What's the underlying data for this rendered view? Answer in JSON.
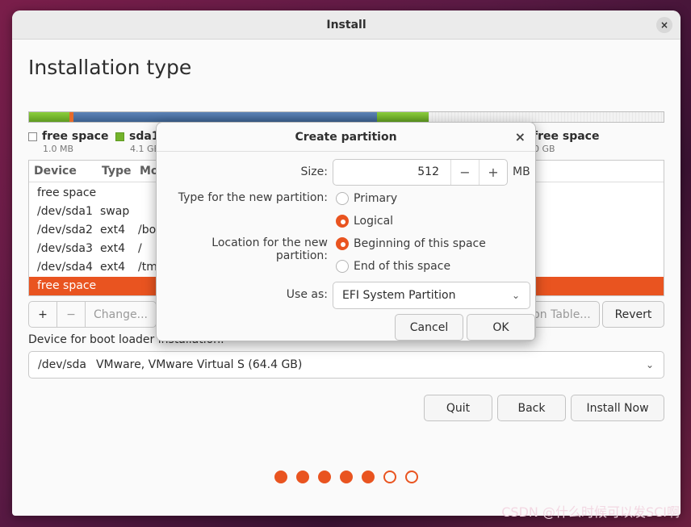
{
  "window": {
    "title": "Install",
    "close_glyph": "×"
  },
  "page_title": "Installation type",
  "partition_bar": {
    "legend": [
      {
        "label": "free space",
        "size": "1.0 MB",
        "color": "#f0f0f0"
      },
      {
        "label": "sda1",
        "size": "4.1 GB",
        "color": "#73b32b"
      },
      {
        "label": "free space",
        "size": "0 GB",
        "color": "#f0f0f0"
      }
    ]
  },
  "table": {
    "headers": [
      "Device",
      "Type",
      "Mo"
    ],
    "rows": [
      {
        "device": "free space",
        "type": "",
        "mount": ""
      },
      {
        "device": "/dev/sda1",
        "type": "swap",
        "mount": ""
      },
      {
        "device": "/dev/sda2",
        "type": "ext4",
        "mount": "/bo"
      },
      {
        "device": "/dev/sda3",
        "type": "ext4",
        "mount": "/"
      },
      {
        "device": "/dev/sda4",
        "type": "ext4",
        "mount": "/tm"
      },
      {
        "device": "free space",
        "type": "",
        "mount": ""
      }
    ]
  },
  "table_buttons": {
    "add": "+",
    "remove": "−",
    "change": "Change...",
    "new_table": "ion Table...",
    "revert": "Revert"
  },
  "boot_loader": {
    "label": "Device for boot loader installation:",
    "device": "/dev/sda",
    "description": "VMware, VMware Virtual S (64.4 GB)"
  },
  "nav_buttons": {
    "quit": "Quit",
    "back": "Back",
    "install": "Install Now"
  },
  "progress": {
    "total_steps": 7,
    "completed_steps": 5
  },
  "dialog": {
    "title": "Create partition",
    "close_glyph": "×",
    "size_label": "Size:",
    "size_value": "512",
    "size_unit": "MB",
    "minus": "−",
    "plus": "+",
    "type_label": "Type for the new partition:",
    "type_primary": "Primary",
    "type_logical": "Logical",
    "location_label": "Location for the new partition:",
    "location_beginning": "Beginning of this space",
    "location_end": "End of this space",
    "use_as_label": "Use as:",
    "use_as_value": "EFI System Partition",
    "cancel": "Cancel",
    "ok": "OK"
  },
  "watermark": "CSDN @什么时候可以发SCI啊",
  "colors": {
    "accent": "#e95420"
  }
}
